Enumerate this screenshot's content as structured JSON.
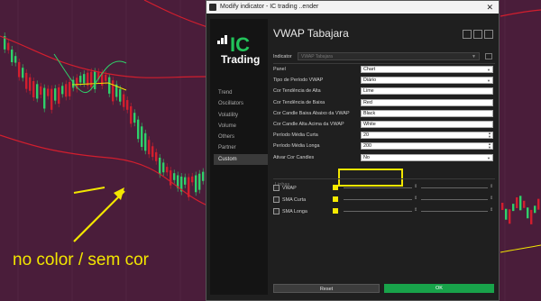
{
  "background": {
    "color": "#4a1d3a",
    "annotation": "no color / sem cor",
    "annotation_color": "#f2e600"
  },
  "dialog": {
    "window_title": "Modify indicator - IC trading ..ender",
    "close_glyph": "✕",
    "logo": {
      "ic": "IC",
      "trading": "Trading",
      "accent": "#22c35a"
    },
    "nav": [
      {
        "label": "Trend",
        "active": false
      },
      {
        "label": "Oscillators",
        "active": false
      },
      {
        "label": "Volatility",
        "active": false
      },
      {
        "label": "Volume",
        "active": false
      },
      {
        "label": "Others",
        "active": false
      },
      {
        "label": "Partner",
        "active": false
      },
      {
        "label": "Custom",
        "active": true
      }
    ],
    "indicator_title": "VWAP Tabajara",
    "indicator_label": "Indicator",
    "indicator_value": "VWAP Tabajara",
    "props": [
      {
        "label": "Panel",
        "value": "Chart",
        "kind": "select"
      },
      {
        "label": "Tipo de Período VWAP",
        "value": "Diário",
        "kind": "select"
      },
      {
        "label": "Cor Tendência de Alta",
        "value": "Lime",
        "kind": "text"
      },
      {
        "label": "Cor Tendência de Baixa",
        "value": "Red",
        "kind": "text"
      },
      {
        "label": "Cor Candle Baixa Abaixo da VWAP",
        "value": "Black",
        "kind": "text"
      },
      {
        "label": "Cor Candle Alta Acima da VWAP",
        "value": "White",
        "kind": "text"
      },
      {
        "label": "Período Média Curta",
        "value": "20",
        "kind": "number"
      },
      {
        "label": "Período Média Longa",
        "value": "200",
        "kind": "number"
      },
      {
        "label": "Ativar Cor Candles",
        "value": "No",
        "kind": "select"
      }
    ],
    "lines_header": "Linhas",
    "lines": [
      {
        "label": "VWAP"
      },
      {
        "label": "SMA Curta"
      },
      {
        "label": "SMA Longa"
      }
    ],
    "swatch_color": "#f6ea00",
    "reset_label": "Reset",
    "ok_label": "OK"
  }
}
